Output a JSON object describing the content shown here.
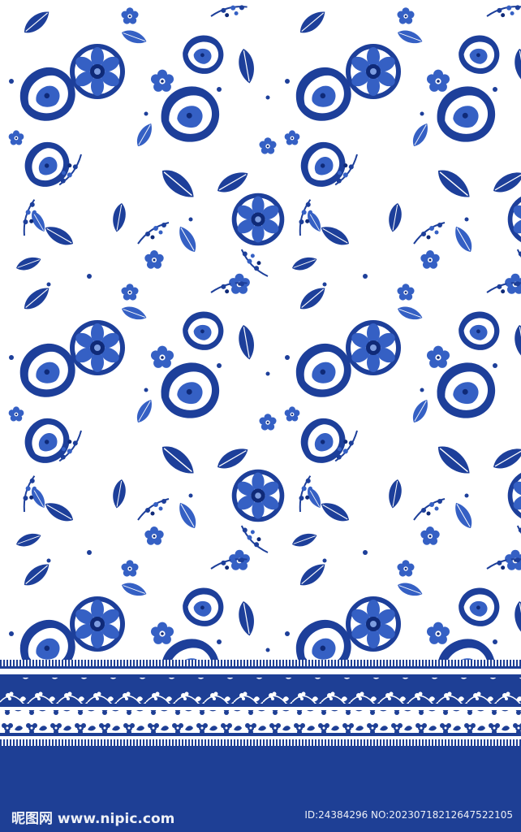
{
  "colors": {
    "background": "#ffffff",
    "primary_blue": "#1d3f9a",
    "mid_blue": "#3560c4",
    "light_blue": "#7d9de0",
    "navy": "#0f2a78",
    "band_blue": "#1e3f95"
  },
  "pattern": {
    "motif": "floral",
    "icons": [
      "flower-icon",
      "leaf-icon",
      "berry-icon"
    ]
  },
  "watermark": {
    "brand": "昵图网 www.nipic.com",
    "id_text": "ID:24384296 NO:20230718212647522105"
  }
}
